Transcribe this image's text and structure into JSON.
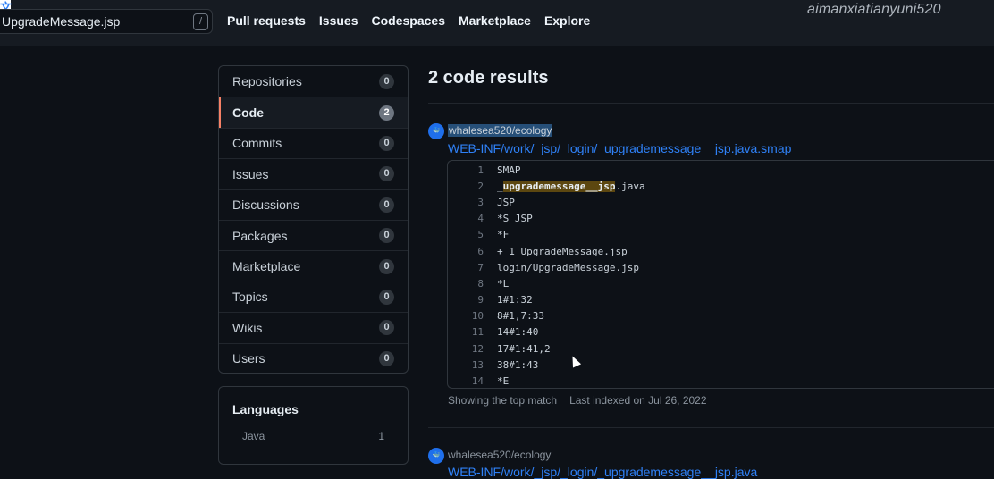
{
  "header": {
    "search_query": "UpgradeMessage.jsp",
    "search_shortcut": "/",
    "nav": [
      "Pull requests",
      "Issues",
      "Codespaces",
      "Marketplace",
      "Explore"
    ],
    "watermark": "aimanxiatianyuni520"
  },
  "sidebar": {
    "facets": [
      {
        "label": "Repositories",
        "count": "0"
      },
      {
        "label": "Code",
        "count": "2",
        "selected": true
      },
      {
        "label": "Commits",
        "count": "0"
      },
      {
        "label": "Issues",
        "count": "0"
      },
      {
        "label": "Discussions",
        "count": "0"
      },
      {
        "label": "Packages",
        "count": "0"
      },
      {
        "label": "Marketplace",
        "count": "0"
      },
      {
        "label": "Topics",
        "count": "0"
      },
      {
        "label": "Wikis",
        "count": "0"
      },
      {
        "label": "Users",
        "count": "0"
      }
    ],
    "languages": {
      "title": "Languages",
      "items": [
        {
          "name": "Java",
          "count": "1"
        }
      ]
    }
  },
  "results": {
    "title": "2 code results",
    "items": [
      {
        "repo": "whalesea520/ecology",
        "path": "WEB-INF/work/_jsp/_login/_upgrademessage__jsp.java.smap",
        "lines": [
          {
            "n": "1",
            "pre": "SMAP",
            "hl": "",
            "post": ""
          },
          {
            "n": "2",
            "pre": "_",
            "hl": "upgrademessage__jsp",
            "post": ".java"
          },
          {
            "n": "3",
            "pre": "JSP",
            "hl": "",
            "post": ""
          },
          {
            "n": "4",
            "pre": "*S JSP",
            "hl": "",
            "post": ""
          },
          {
            "n": "5",
            "pre": "*F",
            "hl": "",
            "post": ""
          },
          {
            "n": "6",
            "pre": "+ 1 UpgradeMessage.jsp",
            "hl": "",
            "post": ""
          },
          {
            "n": "7",
            "pre": "login/UpgradeMessage.jsp",
            "hl": "",
            "post": ""
          },
          {
            "n": "8",
            "pre": "*L",
            "hl": "",
            "post": ""
          },
          {
            "n": "9",
            "pre": "1#1:32",
            "hl": "",
            "post": ""
          },
          {
            "n": "10",
            "pre": "8#1,7:33",
            "hl": "",
            "post": ""
          },
          {
            "n": "11",
            "pre": "14#1:40",
            "hl": "",
            "post": ""
          },
          {
            "n": "12",
            "pre": "17#1:41,2",
            "hl": "",
            "post": ""
          },
          {
            "n": "13",
            "pre": "38#1:43",
            "hl": "",
            "post": ""
          },
          {
            "n": "14",
            "pre": "*E",
            "hl": "",
            "post": ""
          }
        ],
        "meta_match": "Showing the top match",
        "meta_indexed": "Last indexed on Jul 26, 2022"
      },
      {
        "repo": "whalesea520/ecology",
        "path": "WEB-INF/work/_jsp/_login/_upgrademessage__jsp.java"
      }
    ]
  }
}
